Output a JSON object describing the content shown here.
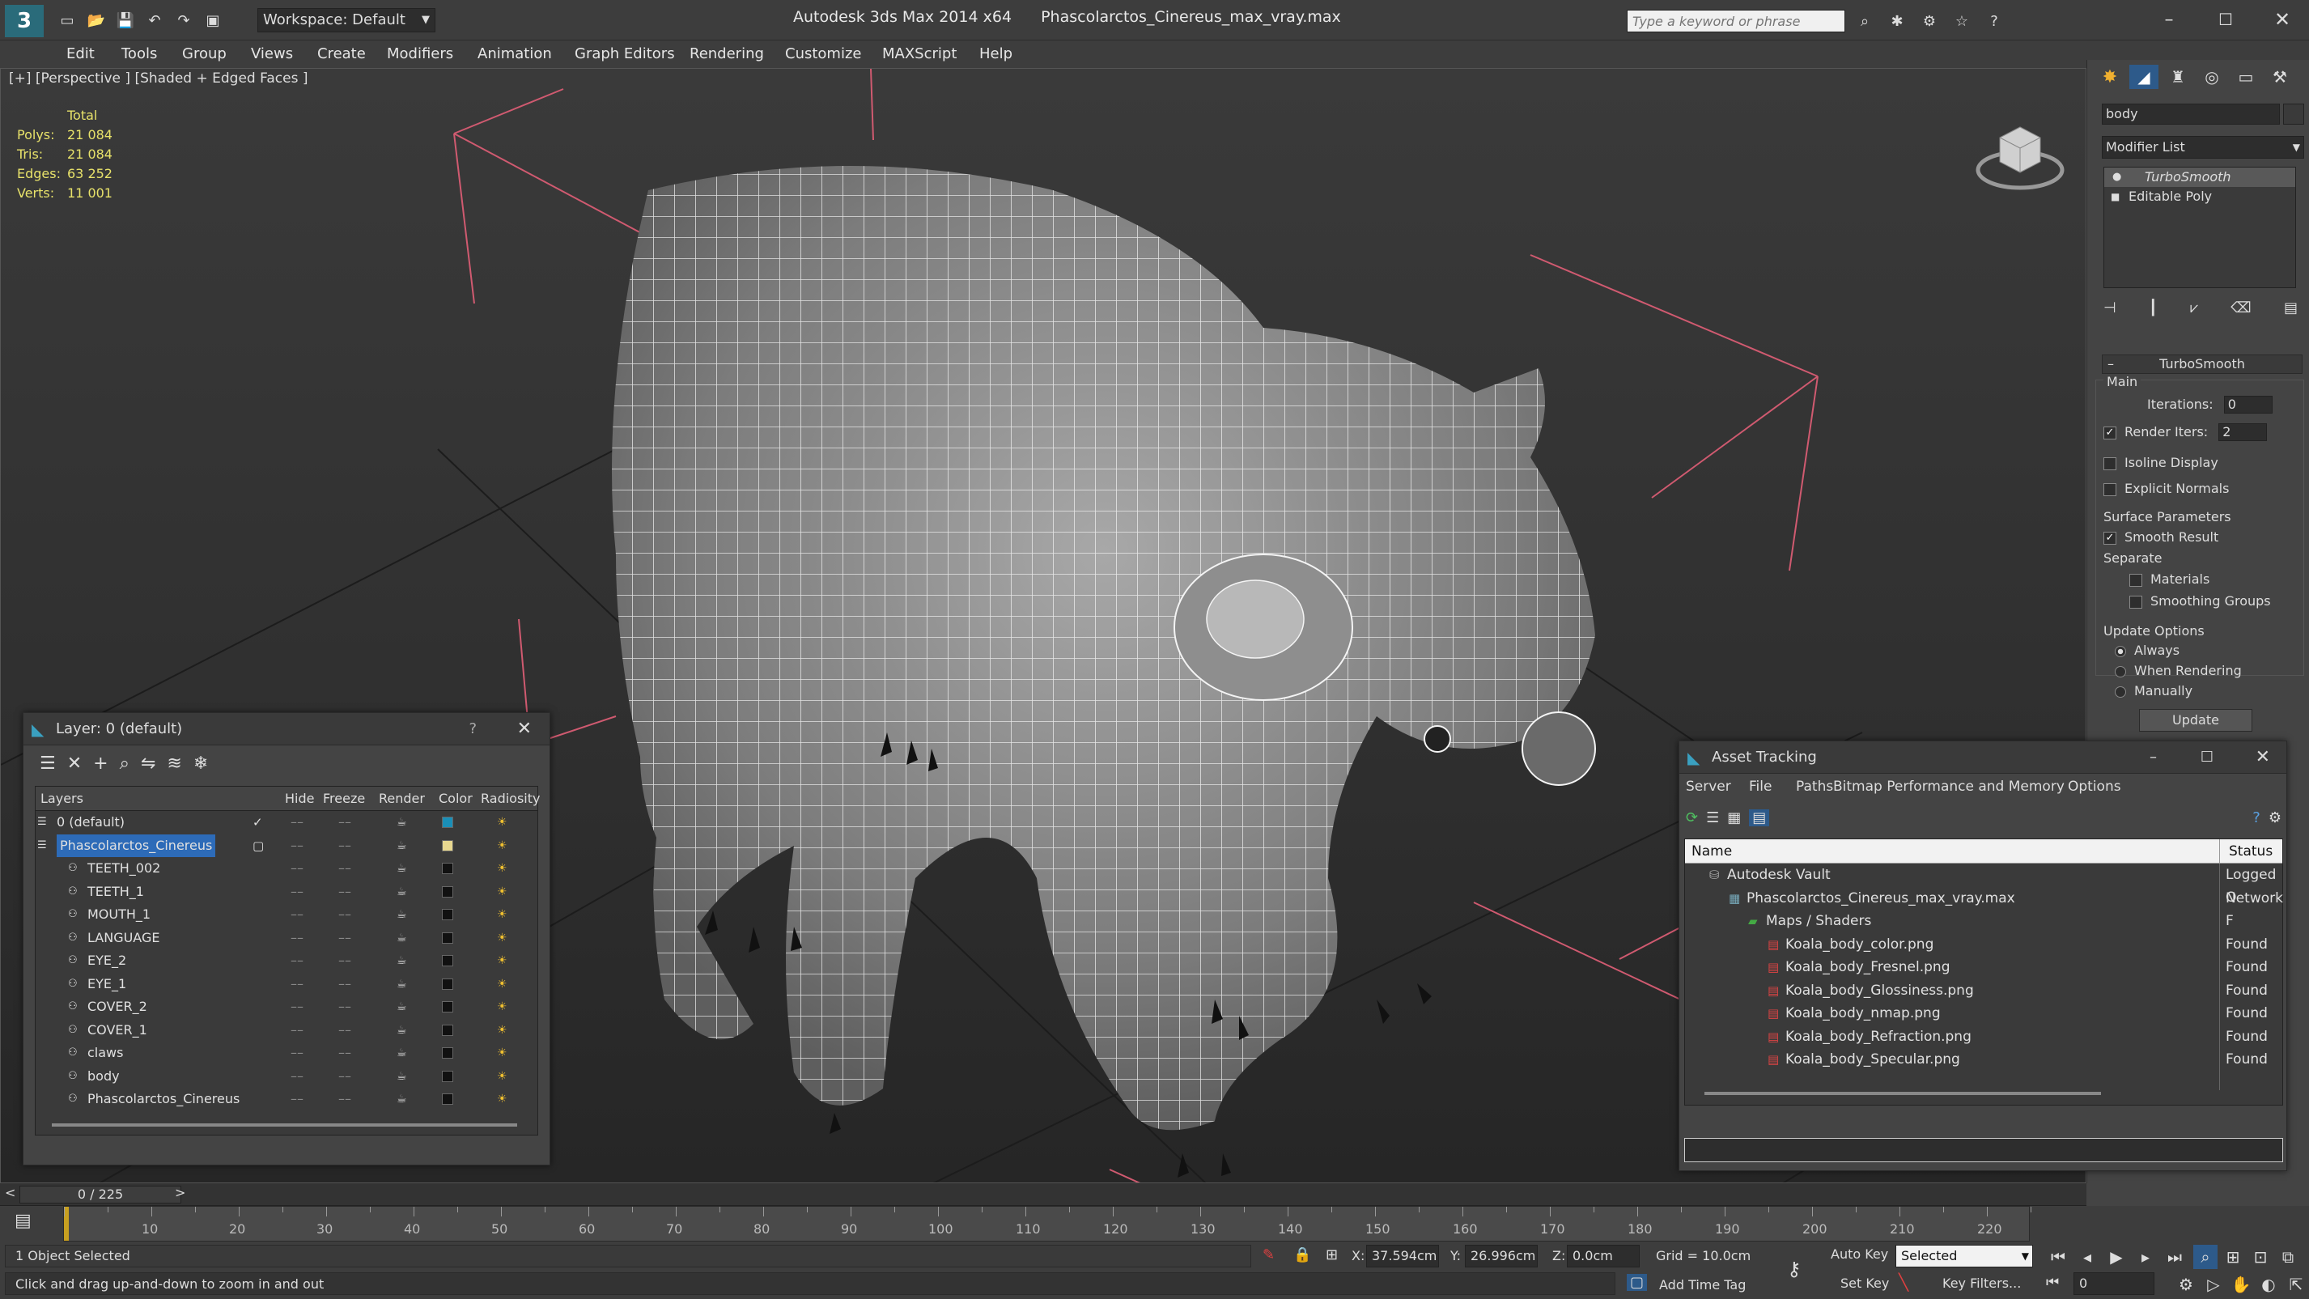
{
  "app": {
    "title": "Autodesk 3ds Max  2014 x64",
    "file": "Phascolarctos_Cinereus_max_vray.max",
    "workspace": "Workspace: Default",
    "search_placeholder": "Type a keyword or phrase"
  },
  "menu": [
    "Edit",
    "Tools",
    "Group",
    "Views",
    "Create",
    "Modifiers",
    "Animation",
    "Graph Editors",
    "Rendering",
    "Customize",
    "MAXScript",
    "Help"
  ],
  "viewport": {
    "label": "[+] [Perspective ] [Shaded + Edged Faces ]",
    "stats": {
      "header": "Total",
      "rows": [
        {
          "label": "Polys:",
          "value": "21 084"
        },
        {
          "label": "Tris:",
          "value": "21 084"
        },
        {
          "label": "Edges:",
          "value": "63 252"
        },
        {
          "label": "Verts:",
          "value": "11 001"
        }
      ]
    }
  },
  "command_panel": {
    "object_name": "body",
    "modifier_list": "Modifier List",
    "stack": [
      "TurboSmooth",
      "Editable Poly"
    ],
    "rollout_title": "TurboSmooth",
    "main_label": "Main",
    "iterations_label": "Iterations:",
    "iterations_value": "0",
    "render_iters_label": "Render Iters:",
    "render_iters_value": "2",
    "isoline": "Isoline Display",
    "explicit_normals": "Explicit Normals",
    "surface_params": "Surface Parameters",
    "smooth_result": "Smooth Result",
    "separate": "Separate",
    "materials": "Materials",
    "smoothing_groups": "Smoothing Groups",
    "update_options": "Update Options",
    "always": "Always",
    "when_rendering": "When Rendering",
    "manually": "Manually",
    "update_button": "Update"
  },
  "layers": {
    "title": "Layer: 0 (default)",
    "help": "?",
    "columns": [
      "Layers",
      "Hide",
      "Freeze",
      "Render",
      "Color",
      "Radiosity"
    ],
    "rows": [
      {
        "name": "0 (default)",
        "level": 0,
        "color": "#1a8fb8"
      },
      {
        "name": "Phascolarctos_Cinereus",
        "level": 0,
        "color": "#e8d890",
        "selected": true
      },
      {
        "name": "TEETH_002",
        "level": 1,
        "color": "#111111"
      },
      {
        "name": "TEETH_1",
        "level": 1,
        "color": "#111111"
      },
      {
        "name": "MOUTH_1",
        "level": 1,
        "color": "#111111"
      },
      {
        "name": "LANGUAGE",
        "level": 1,
        "color": "#111111"
      },
      {
        "name": "EYE_2",
        "level": 1,
        "color": "#111111"
      },
      {
        "name": "EYE_1",
        "level": 1,
        "color": "#111111"
      },
      {
        "name": "COVER_2",
        "level": 1,
        "color": "#111111"
      },
      {
        "name": "COVER_1",
        "level": 1,
        "color": "#111111"
      },
      {
        "name": "claws",
        "level": 1,
        "color": "#111111"
      },
      {
        "name": "body",
        "level": 1,
        "color": "#111111"
      },
      {
        "name": "Phascolarctos_Cinereus",
        "level": 1,
        "color": "#111111"
      }
    ]
  },
  "asset_tracking": {
    "title": "Asset Tracking",
    "menu": [
      "Server",
      "File",
      "Paths",
      "Bitmap Performance and Memory",
      "Options"
    ],
    "columns": [
      "Name",
      "Status"
    ],
    "rows": [
      {
        "name": "Autodesk Vault",
        "level": 0,
        "status": "Logged O"
      },
      {
        "name": "Phascolarctos_Cinereus_max_vray.max",
        "level": 1,
        "status": "Network F"
      },
      {
        "name": "Maps / Shaders",
        "level": 2,
        "status": ""
      },
      {
        "name": "Koala_body_color.png",
        "level": 3,
        "status": "Found"
      },
      {
        "name": "Koala_body_Fresnel.png",
        "level": 3,
        "status": "Found"
      },
      {
        "name": "Koala_body_Glossiness.png",
        "level": 3,
        "status": "Found"
      },
      {
        "name": "Koala_body_nmap.png",
        "level": 3,
        "status": "Found"
      },
      {
        "name": "Koala_body_Refraction.png",
        "level": 3,
        "status": "Found"
      },
      {
        "name": "Koala_body_Specular.png",
        "level": 3,
        "status": "Found"
      }
    ]
  },
  "timeline": {
    "frame": "0 / 225",
    "ticks": [
      "10",
      "20",
      "30",
      "40",
      "50",
      "60",
      "70",
      "80",
      "90",
      "100",
      "110",
      "120",
      "130",
      "140",
      "150",
      "160",
      "170",
      "180",
      "190",
      "200",
      "210",
      "220"
    ]
  },
  "status": {
    "selection": "1 Object Selected",
    "hint": "Click and drag up-and-down to zoom in and out",
    "x_label": "X:",
    "x_value": "37.594cm",
    "y_label": "Y:",
    "y_value": "26.996cm",
    "z_label": "Z:",
    "z_value": "0.0cm",
    "grid": "Grid = 10.0cm",
    "add_time_tag": "Add Time Tag",
    "auto_key": "Auto Key",
    "set_key": "Set Key",
    "selected": "Selected",
    "key_filters": "Key Filters...",
    "frame_field": "0"
  }
}
